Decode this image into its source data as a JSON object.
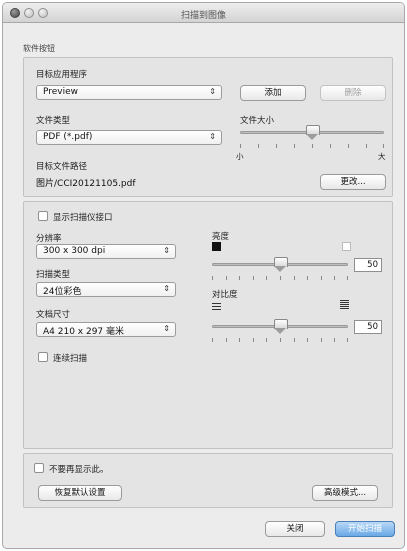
{
  "window": {
    "title": "扫描到图像"
  },
  "section_label": "软件按钮",
  "app": {
    "target_label": "目标应用程序",
    "target_value": "Preview",
    "add_label": "添加",
    "delete_label": "删除"
  },
  "file": {
    "type_label": "文件类型",
    "type_value": "PDF (*.pdf)",
    "size_label": "文件大小",
    "size_small": "小",
    "size_large": "大",
    "size_position": 0.5,
    "path_label": "目标文件路径",
    "path_value": "图片/CCI20121105.pdf",
    "change_label": "更改..."
  },
  "scan": {
    "show_dialog_label": "显示扫描仪接口",
    "resolution_label": "分辨率",
    "resolution_value": "300 x 300 dpi",
    "scan_type_label": "扫描类型",
    "scan_type_value": "24位彩色",
    "doc_size_label": "文档尺寸",
    "doc_size_value": "A4 210 x 297 毫米",
    "continuous_label": "连续扫描",
    "brightness_label": "亮度",
    "brightness_value": "50",
    "contrast_label": "对比度",
    "contrast_value": "50"
  },
  "footer": {
    "dont_show_label": "不要再显示此。",
    "restore_label": "恢复默认设置",
    "advanced_label": "高级模式...",
    "close_label": "关闭",
    "start_label": "开始扫描"
  },
  "icons": {
    "brightness_dark": "black-square-icon",
    "brightness_light": "white-square-icon",
    "contrast_low": "contrast-low-icon",
    "contrast_high": "contrast-high-icon",
    "select_arrow": "updown-arrow-icon"
  },
  "colors": {
    "primary_button": "#6aa8e6",
    "window_bg": "#ececec"
  }
}
